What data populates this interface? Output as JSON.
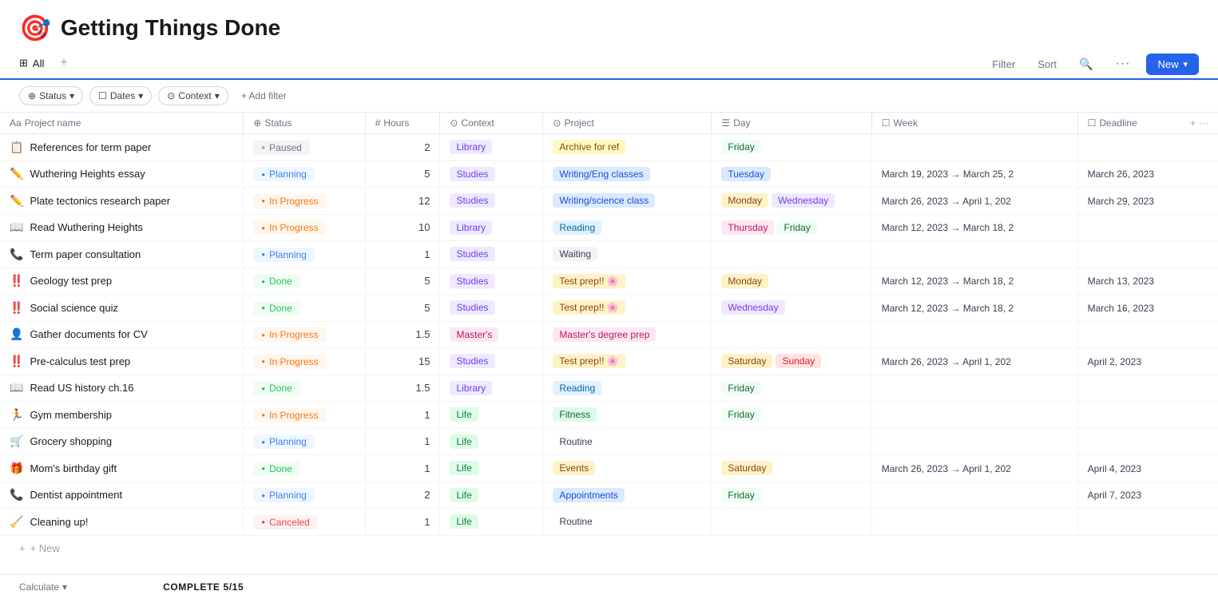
{
  "app": {
    "title": "Getting Things Done",
    "icon": "🎯"
  },
  "toolbar": {
    "tab_label": "All",
    "tab_icon": "⊞",
    "filter_label": "Filter",
    "sort_label": "Sort",
    "search_label": "🔍",
    "more_label": "···",
    "new_label": "New"
  },
  "filters": {
    "status_label": "Status",
    "dates_label": "Dates",
    "context_label": "Context",
    "add_filter_label": "+ Add filter"
  },
  "columns": [
    {
      "id": "project_name",
      "label": "Project name",
      "prefix": "Aa"
    },
    {
      "id": "status",
      "label": "Status",
      "prefix": "⊕"
    },
    {
      "id": "hours",
      "label": "Hours",
      "prefix": "#"
    },
    {
      "id": "context",
      "label": "Context",
      "prefix": "⊙"
    },
    {
      "id": "project",
      "label": "Project",
      "prefix": "⊙"
    },
    {
      "id": "day",
      "label": "Day",
      "prefix": "☰"
    },
    {
      "id": "week",
      "label": "Week",
      "prefix": "☐"
    },
    {
      "id": "deadline",
      "label": "Deadline",
      "prefix": "☐"
    }
  ],
  "rows": [
    {
      "emoji": "📋",
      "name": "References for term paper",
      "status": "Paused",
      "status_class": "paused",
      "hours": 2,
      "context": "Library",
      "context_class": "library",
      "project": "Archive for ref",
      "project_class": "archive",
      "days": [
        "Friday"
      ],
      "day_classes": [
        "friday"
      ],
      "week": "",
      "deadline": ""
    },
    {
      "emoji": "✏️",
      "name": "Wuthering Heights essay",
      "status": "Planning",
      "status_class": "planning",
      "hours": 5,
      "context": "Studies",
      "context_class": "studies",
      "project": "Writing/Eng classes",
      "project_class": "writing-eng",
      "days": [
        "Tuesday"
      ],
      "day_classes": [
        "tuesday"
      ],
      "week": "March 19, 2023 → March 25, 2",
      "deadline": "March 26, 2023"
    },
    {
      "emoji": "✏️",
      "name": "Plate tectonics research paper",
      "status": "In Progress",
      "status_class": "inprogress",
      "hours": 12,
      "context": "Studies",
      "context_class": "studies",
      "project": "Writing/science class",
      "project_class": "writing-sci",
      "days": [
        "Monday",
        "Wednesday"
      ],
      "day_classes": [
        "monday",
        "wednesday"
      ],
      "week": "March 26, 2023 → April 1, 202",
      "deadline": "March 29, 2023"
    },
    {
      "emoji": "📖",
      "name": "Read Wuthering Heights",
      "status": "In Progress",
      "status_class": "inprogress",
      "hours": 10,
      "context": "Library",
      "context_class": "library",
      "project": "Reading",
      "project_class": "reading",
      "days": [
        "Thursday",
        "Friday"
      ],
      "day_classes": [
        "thursday",
        "friday"
      ],
      "week": "March 12, 2023 → March 18, 2",
      "deadline": ""
    },
    {
      "emoji": "📞",
      "name": "Term paper consultation",
      "status": "Planning",
      "status_class": "planning",
      "hours": 1,
      "context": "Studies",
      "context_class": "studies",
      "project": "Waiting",
      "project_class": "waiting",
      "days": [],
      "day_classes": [],
      "week": "",
      "deadline": ""
    },
    {
      "emoji": "‼️",
      "name": "Geology test prep",
      "status": "Done",
      "status_class": "done",
      "hours": 5,
      "context": "Studies",
      "context_class": "studies",
      "project": "Test prep!! 🌸",
      "project_class": "testprep",
      "days": [
        "Monday"
      ],
      "day_classes": [
        "monday"
      ],
      "week": "March 12, 2023 → March 18, 2",
      "deadline": "March 13, 2023"
    },
    {
      "emoji": "‼️",
      "name": "Social science quiz",
      "status": "Done",
      "status_class": "done",
      "hours": 5,
      "context": "Studies",
      "context_class": "studies",
      "project": "Test prep!! 🌸",
      "project_class": "testprep",
      "days": [
        "Wednesday"
      ],
      "day_classes": [
        "wednesday"
      ],
      "week": "March 12, 2023 → March 18, 2",
      "deadline": "March 16, 2023"
    },
    {
      "emoji": "👤",
      "name": "Gather documents for CV",
      "status": "In Progress",
      "status_class": "inprogress",
      "hours": 1.5,
      "context": "Master's",
      "context_class": "masters",
      "project": "Master's degree prep",
      "project_class": "masters",
      "days": [],
      "day_classes": [],
      "week": "",
      "deadline": ""
    },
    {
      "emoji": "‼️",
      "name": "Pre-calculus test prep",
      "status": "In Progress",
      "status_class": "inprogress",
      "hours": 15,
      "context": "Studies",
      "context_class": "studies",
      "project": "Test prep!! 🌸",
      "project_class": "testprep",
      "days": [
        "Saturday",
        "Sunday"
      ],
      "day_classes": [
        "saturday",
        "sunday"
      ],
      "week": "March 26, 2023 → April 1, 202",
      "deadline": "April 2, 2023"
    },
    {
      "emoji": "📖",
      "name": "Read US history ch.16",
      "status": "Done",
      "status_class": "done",
      "hours": 1.5,
      "context": "Library",
      "context_class": "library",
      "project": "Reading",
      "project_class": "reading",
      "days": [
        "Friday"
      ],
      "day_classes": [
        "friday"
      ],
      "week": "",
      "deadline": ""
    },
    {
      "emoji": "🏃",
      "name": "Gym membership",
      "status": "In Progress",
      "status_class": "inprogress",
      "hours": 1,
      "context": "Life",
      "context_class": "life",
      "project": "Fitness",
      "project_class": "fitness",
      "days": [
        "Friday"
      ],
      "day_classes": [
        "friday"
      ],
      "week": "",
      "deadline": ""
    },
    {
      "emoji": "🛒",
      "name": "Grocery shopping",
      "status": "Planning",
      "status_class": "planning",
      "hours": 1,
      "context": "Life",
      "context_class": "life",
      "project": "Routine",
      "project_class": "routine",
      "days": [],
      "day_classes": [],
      "week": "",
      "deadline": ""
    },
    {
      "emoji": "🎁",
      "name": "Mom's birthday gift",
      "status": "Done",
      "status_class": "done",
      "hours": 1,
      "context": "Life",
      "context_class": "life",
      "project": "Events",
      "project_class": "events",
      "days": [
        "Saturday"
      ],
      "day_classes": [
        "saturday"
      ],
      "week": "March 26, 2023 → April 1, 202",
      "deadline": "April 4, 2023"
    },
    {
      "emoji": "📞",
      "name": "Dentist appointment",
      "status": "Planning",
      "status_class": "planning",
      "hours": 2,
      "context": "Life",
      "context_class": "life",
      "project": "Appointments",
      "project_class": "appointments",
      "days": [
        "Friday"
      ],
      "day_classes": [
        "friday"
      ],
      "week": "",
      "deadline": "April 7, 2023"
    },
    {
      "emoji": "🧹",
      "name": "Cleaning up!",
      "status": "Canceled",
      "status_class": "canceled",
      "hours": 1,
      "context": "Life",
      "context_class": "life",
      "project": "Routine",
      "project_class": "routine",
      "days": [],
      "day_classes": [],
      "week": "",
      "deadline": ""
    }
  ],
  "footer": {
    "calculate_label": "Calculate",
    "complete_label": "COMPLETE",
    "complete_count": "5/15",
    "new_label": "+ New"
  }
}
